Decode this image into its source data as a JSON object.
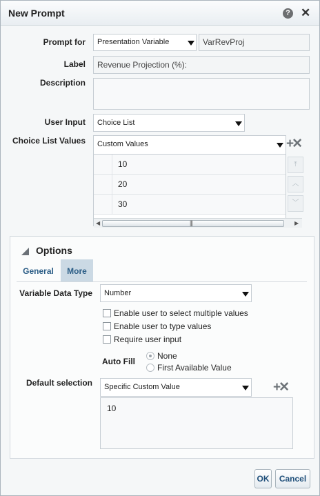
{
  "dialog": {
    "title": "New Prompt"
  },
  "prompt_for": {
    "label": "Prompt for",
    "type_value": "Presentation Variable",
    "variable_value": "VarRevProj"
  },
  "label_field": {
    "label": "Label",
    "value": "Revenue Projection (%):"
  },
  "description": {
    "label": "Description",
    "value": ""
  },
  "user_input": {
    "label": "User Input",
    "value": "Choice List"
  },
  "choice_list": {
    "label": "Choice List Values",
    "mode_value": "Custom Values",
    "values": [
      "10",
      "20",
      "30"
    ]
  },
  "options": {
    "header": "Options",
    "tabs": [
      "General",
      "More"
    ],
    "active_tab": "More",
    "variable_data_type": {
      "label": "Variable Data Type",
      "value": "Number"
    },
    "checkboxes": [
      {
        "label": "Enable user to select multiple values",
        "checked": false
      },
      {
        "label": "Enable user to type values",
        "checked": false
      },
      {
        "label": "Require user input",
        "checked": false
      }
    ],
    "auto_fill": {
      "label": "Auto Fill",
      "options": [
        "None",
        "First Available Value"
      ],
      "selected": "None"
    },
    "default_selection": {
      "label": "Default selection",
      "value": "Specific Custom Value",
      "custom_value": "10"
    }
  },
  "buttons": {
    "ok": "OK",
    "cancel": "Cancel"
  },
  "icons": {
    "help": "help-icon",
    "close": "close-icon",
    "add_remove": "add-remove-icon"
  },
  "colors": {
    "tab_active": "#cbd9e4",
    "link_blue": "#2b5d86"
  }
}
